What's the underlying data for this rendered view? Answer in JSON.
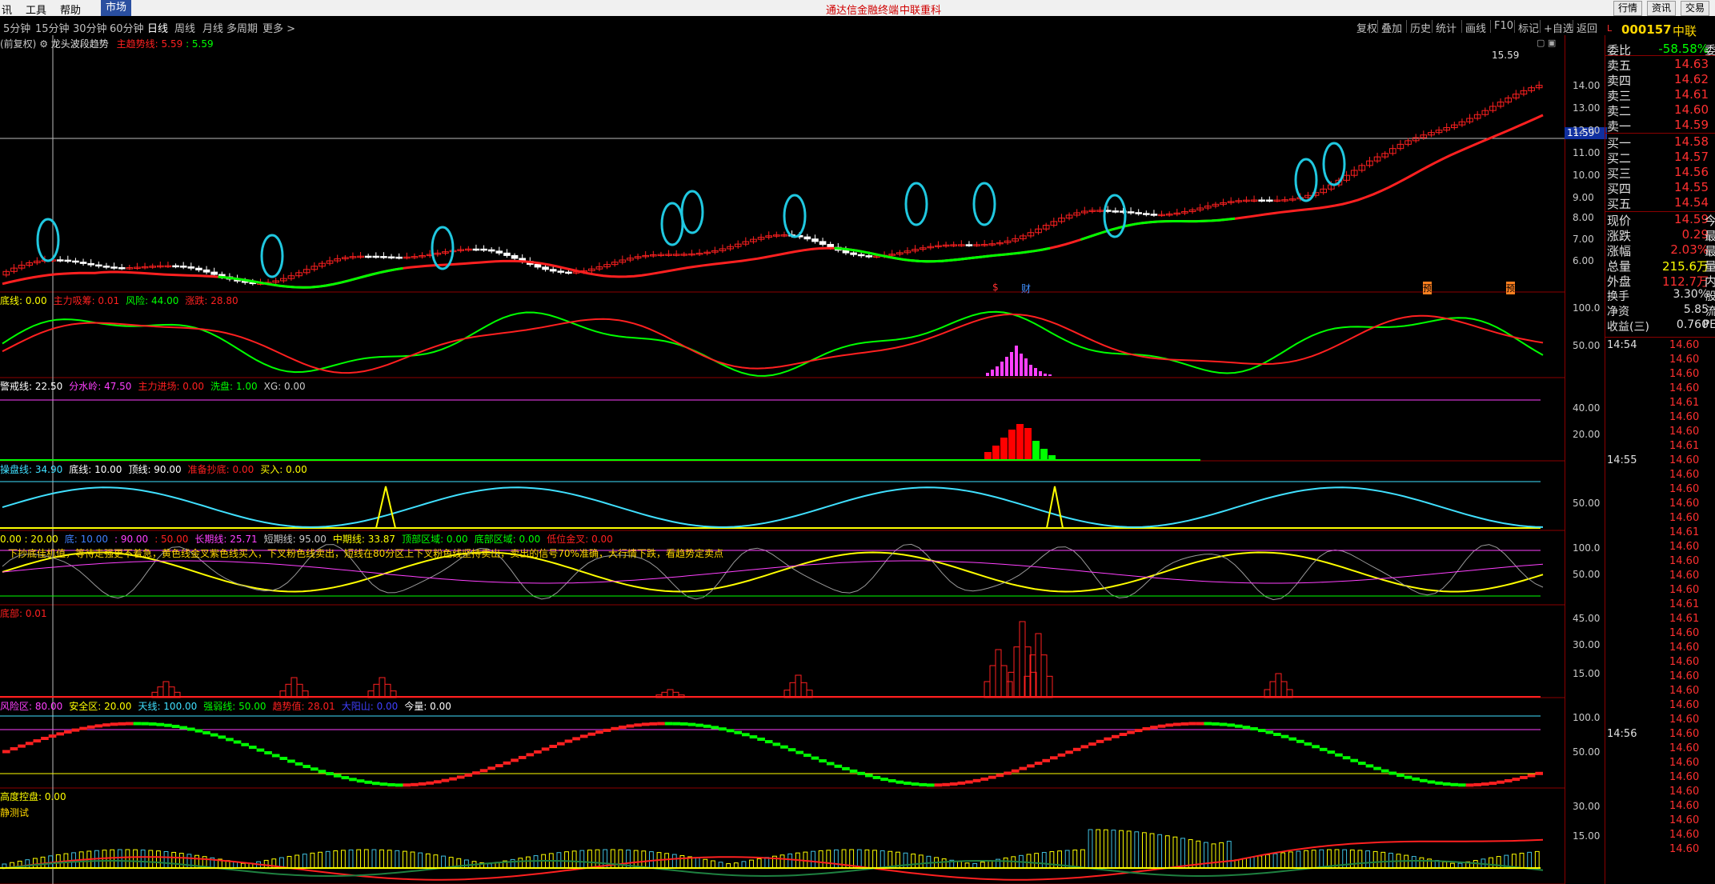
{
  "menubar": {
    "items": [
      "讯",
      "工具",
      "帮助"
    ],
    "market": "市场",
    "center_title": "通达信金融终端",
    "center_sub": "中联重科",
    "right_buttons": [
      "行情",
      "资讯",
      "交易"
    ]
  },
  "periods": {
    "items": [
      "5分钟",
      "15分钟",
      "30分钟",
      "60分钟",
      "日线",
      "周线",
      "月线",
      "多周期",
      "更多 >"
    ],
    "selected": "日线"
  },
  "toolbar": {
    "items": [
      "复权",
      "叠加",
      "历史",
      "统计",
      "画线",
      "F10",
      "标记",
      "+自选",
      "返回"
    ]
  },
  "chart_header": {
    "mode": "(前复权)",
    "indicator": "龙头波段趋势",
    "main_line_label": "主趋势线",
    "main_line_value1": "5.59",
    "main_line_value2": "5.59"
  },
  "main_chart": {
    "price_ticks": [
      "14.00",
      "13.00",
      "12.00",
      "11.00",
      "10.00",
      "9.00",
      "8.00",
      "7.00",
      "6.00"
    ],
    "high_label": "15.59",
    "cursor_price": "11.59",
    "event_markers": [
      "$",
      "财",
      "预",
      "预"
    ]
  },
  "panels": [
    {
      "legend": [
        {
          "t": "底线: 0.00",
          "c": "#ffff00"
        },
        {
          "t": "主力吸筹: 0.01",
          "c": "#ff2020"
        },
        {
          "t": "风险: 44.00",
          "c": "#00ff00"
        },
        {
          "t": "涨跌: 28.80",
          "c": "#ff2020"
        }
      ],
      "ticks": [
        "100.0",
        "50.00"
      ]
    },
    {
      "legend": [
        {
          "t": "警戒线: 22.50",
          "c": "#ffffff"
        },
        {
          "t": "分水岭: 47.50",
          "c": "#ff40ff"
        },
        {
          "t": "主力进场: 0.00",
          "c": "#ff2020"
        },
        {
          "t": "洗盘: 1.00",
          "c": "#00ff00"
        },
        {
          "t": "XG: 0.00",
          "c": "#c8c8c8"
        }
      ],
      "ticks": [
        "40.00",
        "20.00"
      ]
    },
    {
      "legend": [
        {
          "t": "操盘线: 34.90",
          "c": "#40e0ff"
        },
        {
          "t": "底线: 10.00",
          "c": "#ffffff"
        },
        {
          "t": "顶线: 90.00",
          "c": "#ffffff"
        },
        {
          "t": "准备抄底: 0.00",
          "c": "#ff2020"
        },
        {
          "t": "买入: 0.00",
          "c": "#ffff00"
        }
      ],
      "ticks": [
        "50.00"
      ]
    },
    {
      "legend": [
        {
          "t": "0.00 : 20.00",
          "c": "#ffff00"
        },
        {
          "t": "底: 10.00",
          "c": "#4080ff"
        },
        {
          "t": ": 90.00",
          "c": "#ff40ff"
        },
        {
          "t": ": 50.00",
          "c": "#ff2020"
        },
        {
          "t": "长期线: 25.71",
          "c": "#ff40ff"
        },
        {
          "t": "短期线: 95.00",
          "c": "#c8c8c8"
        },
        {
          "t": "中期线: 33.87",
          "c": "#ffff00"
        },
        {
          "t": "顶部区域: 0.00",
          "c": "#00ff00"
        },
        {
          "t": "底部区域: 0.00",
          "c": "#00ff00"
        },
        {
          "t": "低位金叉: 0.00",
          "c": "#ff2020"
        }
      ],
      "note": "下抄底佳机值，等待走强更不着急，黄色线金叉紫色线买入，下叉粉色线卖出，短线在80分区上下叉粉色线坚持卖出，卖出的信号70%准确，大行情下跌，看趋势定卖点",
      "ticks": [
        "100.0",
        "50.00"
      ]
    },
    {
      "legend": [
        {
          "t": "底部: 0.01",
          "c": "#ff2020"
        }
      ],
      "ticks": [
        "45.00",
        "30.00",
        "15.00"
      ]
    },
    {
      "legend": [
        {
          "t": "风险区: 80.00",
          "c": "#ff40ff"
        },
        {
          "t": "安全区: 20.00",
          "c": "#ffff00"
        },
        {
          "t": "天线: 100.00",
          "c": "#40e0ff"
        },
        {
          "t": "强弱线: 50.00",
          "c": "#00ff00"
        },
        {
          "t": "趋势值: 28.01",
          "c": "#ff2020"
        },
        {
          "t": "大阳山: 0.00",
          "c": "#4040ff"
        },
        {
          "t": "今量: 0.00",
          "c": "#ffffff"
        }
      ],
      "ticks": [
        "100.0",
        "50.00"
      ]
    },
    {
      "legend": [
        {
          "t": "高度控盘: 0.00",
          "c": "#ffff00"
        }
      ],
      "sub": "静测试",
      "ticks": [
        "30.00",
        "15.00"
      ]
    }
  ],
  "quote": {
    "header_code": "000157",
    "header_name": "中联",
    "weibi_label": "委比",
    "weibi_value": "-58.58%",
    "weibi_extra": "委",
    "sell": [
      {
        "label": "卖五",
        "price": "14.63"
      },
      {
        "label": "卖四",
        "price": "14.62"
      },
      {
        "label": "卖三",
        "price": "14.61"
      },
      {
        "label": "卖二",
        "price": "14.60"
      },
      {
        "label": "卖一",
        "price": "14.59"
      }
    ],
    "buy": [
      {
        "label": "买一",
        "price": "14.58"
      },
      {
        "label": "买二",
        "price": "14.57"
      },
      {
        "label": "买三",
        "price": "14.56"
      },
      {
        "label": "买四",
        "price": "14.55"
      },
      {
        "label": "买五",
        "price": "14.54"
      }
    ],
    "stats": [
      {
        "label": "现价",
        "value": "14.59",
        "extra": "今",
        "color": "#ff3030"
      },
      {
        "label": "涨跌",
        "value": "0.29",
        "extra": "最",
        "color": "#ff3030"
      },
      {
        "label": "涨幅",
        "value": "2.03%",
        "extra": "最",
        "color": "#ff3030"
      },
      {
        "label": "总量",
        "value": "215.6万",
        "extra": "量",
        "color": "#ffff00"
      },
      {
        "label": "外盘",
        "value": "112.7万",
        "extra": "内",
        "color": "#ff3030"
      },
      {
        "label": "换手",
        "value": "3.30%",
        "extra": "股",
        "color": "#e0e0e0"
      },
      {
        "label": "净资",
        "value": "5.85",
        "extra": "流",
        "color": "#e0e0e0"
      },
      {
        "label": "收益(三)",
        "value": "0.760",
        "extra": "PE",
        "color": "#e0e0e0"
      }
    ],
    "ticks": [
      {
        "time": "14:54",
        "price": "14.60"
      },
      {
        "time": "",
        "price": "14.60"
      },
      {
        "time": "",
        "price": "14.60"
      },
      {
        "time": "",
        "price": "14.60"
      },
      {
        "time": "",
        "price": "14.61"
      },
      {
        "time": "",
        "price": "14.60"
      },
      {
        "time": "",
        "price": "14.60"
      },
      {
        "time": "",
        "price": "14.61"
      },
      {
        "time": "14:55",
        "price": "14.60"
      },
      {
        "time": "",
        "price": "14.60"
      },
      {
        "time": "",
        "price": "14.60"
      },
      {
        "time": "",
        "price": "14.60"
      },
      {
        "time": "",
        "price": "14.60"
      },
      {
        "time": "",
        "price": "14.61"
      },
      {
        "time": "",
        "price": "14.60"
      },
      {
        "time": "",
        "price": "14.60"
      },
      {
        "time": "",
        "price": "14.60"
      },
      {
        "time": "",
        "price": "14.60"
      },
      {
        "time": "",
        "price": "14.61"
      },
      {
        "time": "",
        "price": "14.61"
      },
      {
        "time": "",
        "price": "14.60"
      },
      {
        "time": "",
        "price": "14.60"
      },
      {
        "time": "",
        "price": "14.60"
      },
      {
        "time": "",
        "price": "14.60"
      },
      {
        "time": "",
        "price": "14.60"
      },
      {
        "time": "",
        "price": "14.60"
      },
      {
        "time": "",
        "price": "14.60"
      },
      {
        "time": "14:56",
        "price": "14.60"
      },
      {
        "time": "",
        "price": "14.60"
      },
      {
        "time": "",
        "price": "14.60"
      },
      {
        "time": "",
        "price": "14.60"
      },
      {
        "time": "",
        "price": "14.60"
      },
      {
        "time": "",
        "price": "14.60"
      },
      {
        "time": "",
        "price": "14.60"
      },
      {
        "time": "",
        "price": "14.60"
      },
      {
        "time": "",
        "price": "14.60"
      }
    ]
  },
  "colors": {
    "up": "#ff2020",
    "down": "#00ff00",
    "cyan": "#20c8e0",
    "yellow": "#ffff00",
    "magenta": "#ff40ff",
    "axis": "#8b0000"
  }
}
